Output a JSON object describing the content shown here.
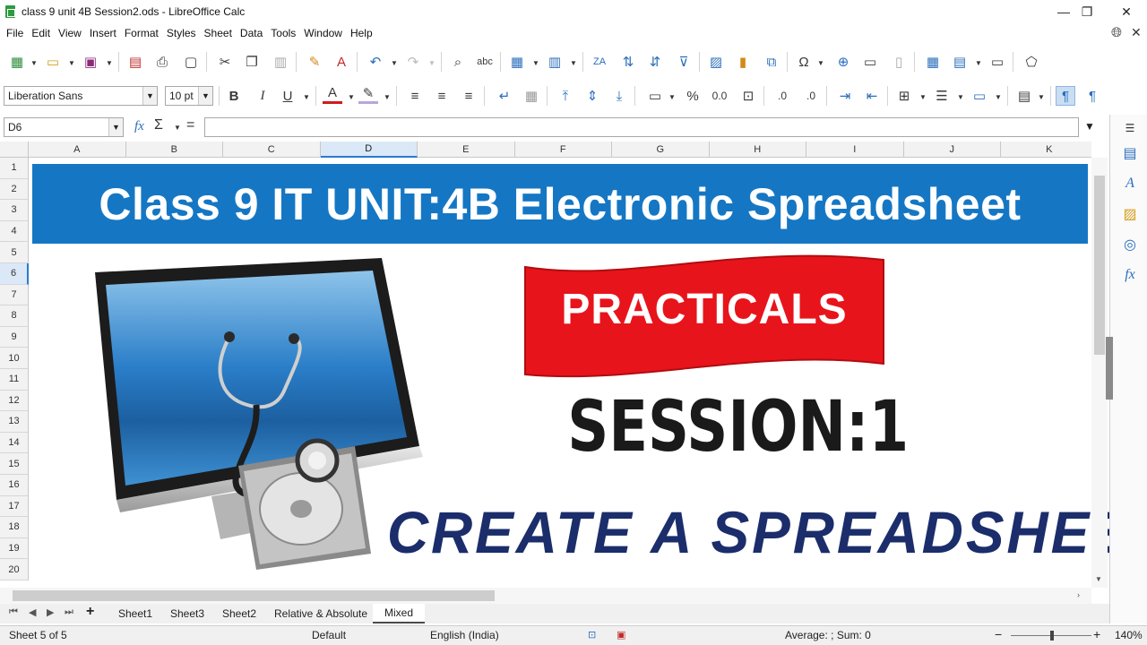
{
  "window": {
    "title": "class 9 unit 4B Session2.ods - LibreOffice Calc",
    "minimize": "—",
    "maximize": "❐",
    "close": "✕"
  },
  "menu": [
    "File",
    "Edit",
    "View",
    "Insert",
    "Format",
    "Styles",
    "Sheet",
    "Data",
    "Tools",
    "Window",
    "Help"
  ],
  "formatting": {
    "font_name": "Liberation Sans",
    "font_size": "10 pt"
  },
  "formula_bar": {
    "cell_ref": "D6",
    "fx": "fx",
    "sigma": "Σ",
    "equals": "="
  },
  "columns": [
    "A",
    "B",
    "C",
    "D",
    "E",
    "F",
    "G",
    "H",
    "I",
    "J",
    "K"
  ],
  "selected_column": "D",
  "rows": [
    "1",
    "2",
    "3",
    "4",
    "5",
    "6",
    "7",
    "8",
    "9",
    "10",
    "11",
    "12",
    "13",
    "14",
    "15",
    "16",
    "17",
    "18",
    "19",
    "20"
  ],
  "selected_row": "6",
  "content": {
    "banner_title": "Class 9 IT UNIT:4B Electronic Spreadsheet",
    "ribbon_text": "PRACTICALS",
    "session_text": "SESSION:1",
    "create_text": "CREATE A SPREADSHEET",
    "banner_color": "#1577c4",
    "ribbon_color": "#e8141b"
  },
  "sheet_tabs": {
    "add": "+",
    "tabs": [
      "Sheet1",
      "Sheet3",
      "Sheet2",
      "Relative & Absolute",
      "Mixed"
    ],
    "active": "Mixed"
  },
  "status": {
    "sheet_pos": "Sheet 5 of 5",
    "page_style": "Default",
    "language": "English (India)",
    "summary": "Average: ; Sum: 0",
    "zoom": "140%",
    "zoom_minus": "−",
    "zoom_plus": "+"
  }
}
